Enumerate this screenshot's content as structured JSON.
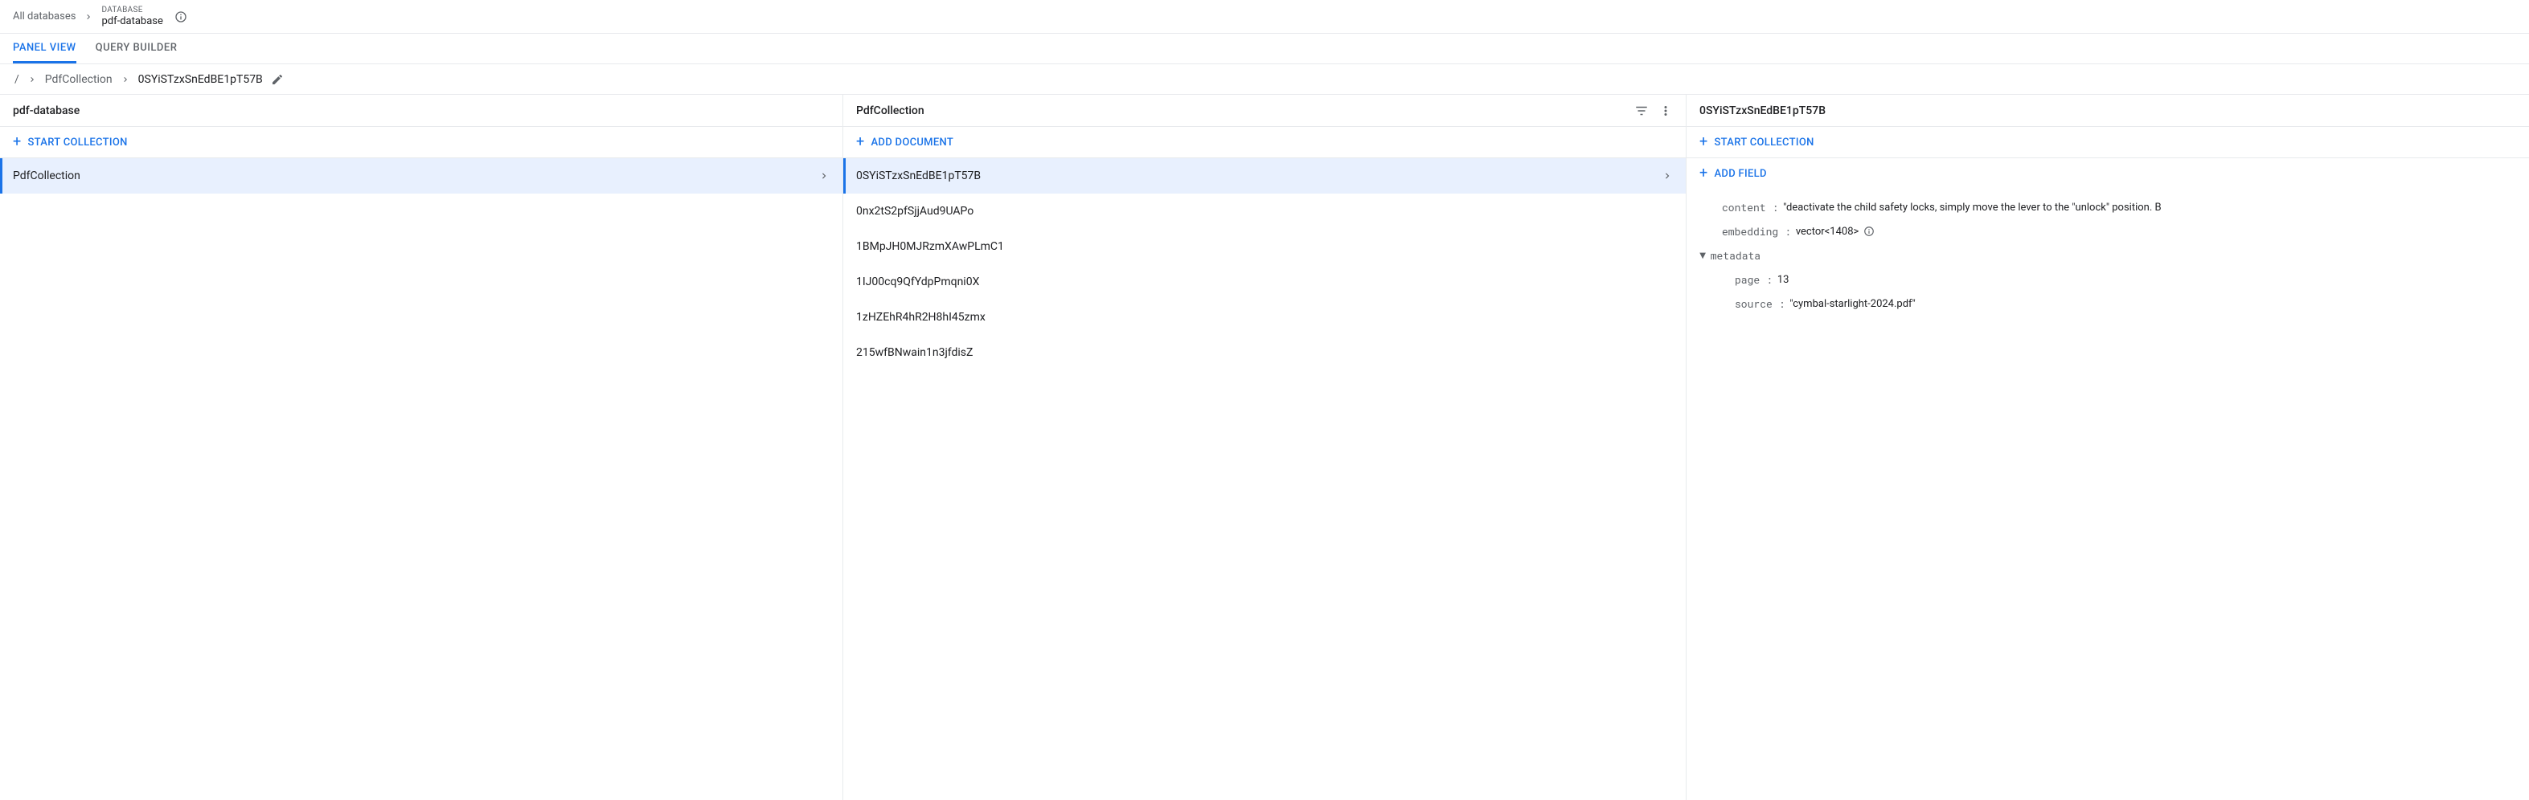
{
  "top": {
    "all_databases": "All databases",
    "db_label": "DATABASE",
    "db_name": "pdf-database"
  },
  "tabs": {
    "panel_view": "PANEL VIEW",
    "query_builder": "QUERY BUILDER"
  },
  "breadcrumb": {
    "root": "/",
    "collection": "PdfCollection",
    "doc": "0SYiSTzxSnEdBE1pT57B"
  },
  "panel1": {
    "title": "pdf-database",
    "start_collection": "START COLLECTION",
    "items": [
      "PdfCollection"
    ]
  },
  "panel2": {
    "title": "PdfCollection",
    "add_document": "ADD DOCUMENT",
    "items": [
      "0SYiSTzxSnEdBE1pT57B",
      "0nx2tS2pfSjjAud9UAPo",
      "1BMpJH0MJRzmXAwPLmC1",
      "1IJ00cq9QfYdpPmqni0X",
      "1zHZEhR4hR2H8hI45zmx",
      "215wfBNwain1n3jfdisZ"
    ]
  },
  "panel3": {
    "title": "0SYiSTzxSnEdBE1pT57B",
    "start_collection": "START COLLECTION",
    "add_field": "ADD FIELD",
    "fields": {
      "content_key": "content",
      "content_val": "\"deactivate the child safety locks, simply move the lever to the \"unlock\" position. B",
      "embedding_key": "embedding",
      "embedding_val": "vector<1408>",
      "metadata_key": "metadata",
      "page_key": "page",
      "page_val": "13",
      "source_key": "source",
      "source_val": "\"cymbal-starlight-2024.pdf\""
    }
  }
}
